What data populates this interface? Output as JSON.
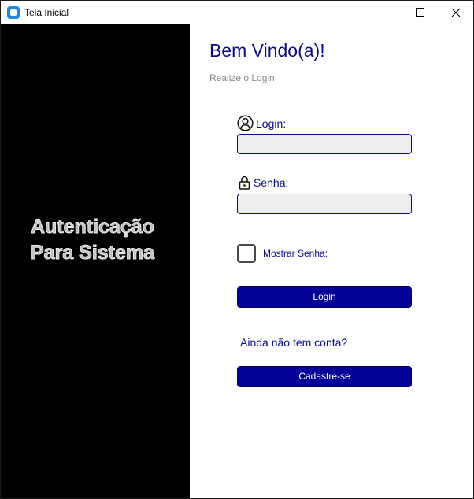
{
  "window": {
    "title": "Tela Inicial",
    "controls": {
      "minimize_icon": "minimize-icon",
      "maximize_icon": "maximize-icon",
      "close_icon": "close-icon"
    }
  },
  "left_panel": {
    "line1": "Autenticação",
    "line2": "Para Sistema"
  },
  "header": {
    "welcome": "Bem Vindo(a)!",
    "subtitle": "Realize o Login"
  },
  "form": {
    "login_label": "Login:",
    "login_icon": "user-circle-icon",
    "login_value": "",
    "password_label": "Senha:",
    "password_icon": "lock-icon",
    "password_value": "",
    "show_password_label": "Mostrar Senha:",
    "show_password_checked": false,
    "login_button": "Login",
    "no_account_text": "Ainda não tem conta?",
    "register_button": "Cadastre-se"
  },
  "colors": {
    "accent": "#03039a",
    "label_text": "#0a0a8c",
    "input_bg": "#eeeeee",
    "left_panel_bg": "#000000",
    "brand_text": "#bdbdbd"
  }
}
